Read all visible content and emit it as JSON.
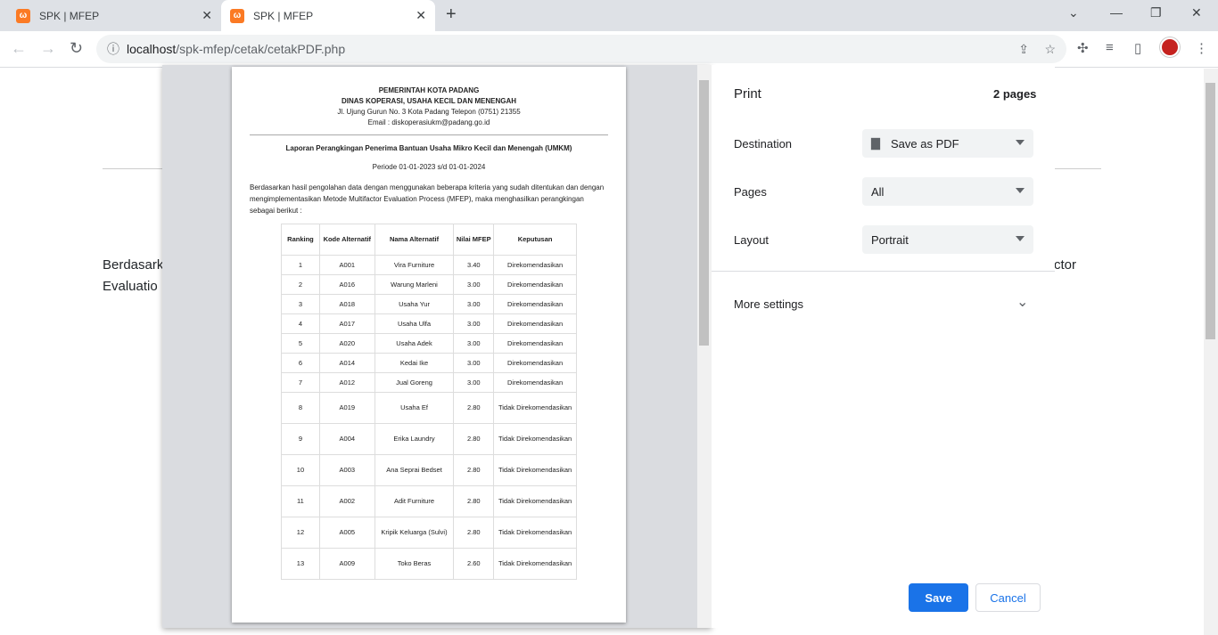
{
  "browser": {
    "tabs": [
      {
        "title": "SPK | MFEP",
        "active": false
      },
      {
        "title": "SPK | MFEP",
        "active": true
      }
    ],
    "url_host": "localhost",
    "url_path": "/spk-mfep/cetak/cetakPDF.php"
  },
  "background_page": {
    "fragments": [
      "Berdasark",
      "Evaluatio",
      "ctor"
    ]
  },
  "document": {
    "header": [
      "PEMERINTAH KOTA PADANG",
      "DINAS KOPERASI, USAHA KECIL DAN MENENGAH"
    ],
    "address": "Jl. Ujung Gurun No. 3 Kota Padang Telepon (0751) 21355",
    "email": "Email : diskoperasiukm@padang.go.id",
    "title": "Laporan Perangkingan Penerima Bantuan Usaha Mikro Kecil dan Menengah (UMKM)",
    "period": "Periode 01-01-2023 s/d 01-01-2024",
    "paragraph": "Berdasarkan hasil pengolahan data dengan menggunakan beberapa kriteria yang sudah ditentukan dan dengan mengimplementasikan Metode Multifactor Evaluation Process (MFEP), maka menghasilkan perangkingan sebagai berikut :",
    "columns": [
      "Ranking",
      "Kode Alternatif",
      "Nama Alternatif",
      "Nilai MFEP",
      "Keputusan"
    ],
    "rows": [
      [
        "1",
        "A001",
        "Vira Furniture",
        "3.40",
        "Direkomendasikan"
      ],
      [
        "2",
        "A016",
        "Warung Marleni",
        "3.00",
        "Direkomendasikan"
      ],
      [
        "3",
        "A018",
        "Usaha Yur",
        "3.00",
        "Direkomendasikan"
      ],
      [
        "4",
        "A017",
        "Usaha Ulfa",
        "3.00",
        "Direkomendasikan"
      ],
      [
        "5",
        "A020",
        "Usaha Adek",
        "3.00",
        "Direkomendasikan"
      ],
      [
        "6",
        "A014",
        "Kedai Ike",
        "3.00",
        "Direkomendasikan"
      ],
      [
        "7",
        "A012",
        "Jual Goreng",
        "3.00",
        "Direkomendasikan"
      ],
      [
        "8",
        "A019",
        "Usaha Ef",
        "2.80",
        "Tidak Direkomendasikan"
      ],
      [
        "9",
        "A004",
        "Erika Laundry",
        "2.80",
        "Tidak Direkomendasikan"
      ],
      [
        "10",
        "A003",
        "Ana Seprai Bedset",
        "2.80",
        "Tidak Direkomendasikan"
      ],
      [
        "11",
        "A002",
        "Adit Furniture",
        "2.80",
        "Tidak Direkomendasikan"
      ],
      [
        "12",
        "A005",
        "Kripik Keluarga (Sulvi)",
        "2.80",
        "Tidak Direkomendasikan"
      ],
      [
        "13",
        "A009",
        "Toko Beras",
        "2.60",
        "Tidak Direkomendasikan"
      ]
    ]
  },
  "print": {
    "title": "Print",
    "pages_count": "2 pages",
    "destination_label": "Destination",
    "destination_value": "Save as PDF",
    "pages_label": "Pages",
    "pages_value": "All",
    "layout_label": "Layout",
    "layout_value": "Portrait",
    "more_settings": "More settings",
    "save": "Save",
    "cancel": "Cancel",
    "accent": "#1a73e8"
  }
}
